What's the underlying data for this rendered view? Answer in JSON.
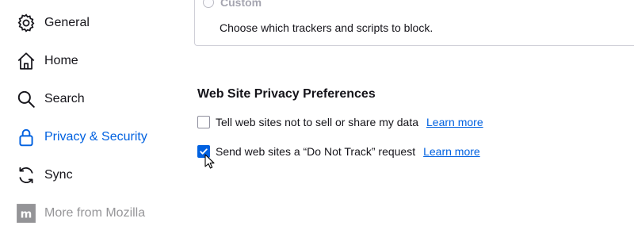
{
  "sidebar": {
    "items": [
      {
        "label": "General",
        "icon": "gear-icon"
      },
      {
        "label": "Home",
        "icon": "home-icon"
      },
      {
        "label": "Search",
        "icon": "search-icon"
      },
      {
        "label": "Privacy & Security",
        "icon": "lock-icon",
        "selected": true
      },
      {
        "label": "Sync",
        "icon": "sync-icon"
      },
      {
        "label": "More from Mozilla",
        "icon": "mozilla-icon"
      }
    ]
  },
  "tracking": {
    "option_label": "Custom",
    "description": "Choose which trackers and scripts to block."
  },
  "privacy_prefs": {
    "title": "Web Site Privacy Preferences",
    "options": [
      {
        "label": "Tell web sites not to sell or share my data",
        "checked": false,
        "link": "Learn more"
      },
      {
        "label": "Send web sites a “Do Not Track” request",
        "checked": true,
        "link": "Learn more"
      }
    ]
  },
  "colors": {
    "accent": "#0061e0",
    "text": "#15141a",
    "border": "#cfcfd8"
  }
}
